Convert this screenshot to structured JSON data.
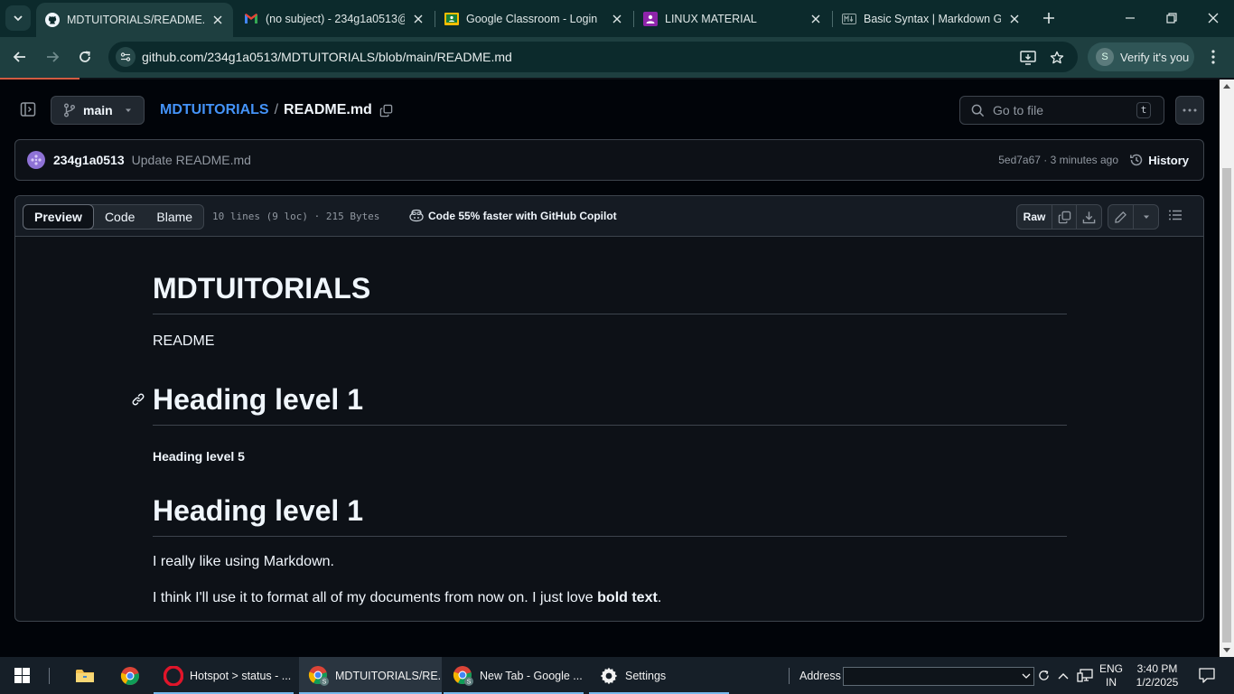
{
  "browser": {
    "tabs": [
      {
        "title": "MDTUITORIALS/README.md",
        "icon": "github-icon",
        "active": true
      },
      {
        "title": "(no subject) - 234g1a0513@",
        "icon": "gmail-icon",
        "active": false
      },
      {
        "title": "Google Classroom - Login",
        "icon": "classroom-icon",
        "active": false
      },
      {
        "title": "LINUX MATERIAL",
        "icon": "classroom-purple-icon",
        "active": false
      },
      {
        "title": "Basic Syntax | Markdown Gu",
        "icon": "markdown-icon",
        "active": false
      }
    ],
    "url": "github.com/234g1a0513/MDTUITORIALS/blob/main/README.md",
    "profile_initial": "S",
    "verify_label": "Verify it's you"
  },
  "repo": {
    "branch": "main",
    "repo_name": "MDTUITORIALS",
    "separator": "/",
    "file_name": "README.md",
    "go_to_file_placeholder": "Go to file",
    "shortcut_key": "t"
  },
  "commit": {
    "author": "234g1a0513",
    "message": "Update README.md",
    "meta": "5ed7a67 · 3 minutes ago",
    "history_label": "History"
  },
  "file_header": {
    "tabs": [
      "Preview",
      "Code",
      "Blame"
    ],
    "active_tab": "Preview",
    "stats": "10 lines (9 loc) · 215 Bytes",
    "copilot_label": "Code 55% faster with GitHub Copilot",
    "raw_label": "Raw"
  },
  "markdown": {
    "title": "MDTUITORIALS",
    "subtitle": "README",
    "heading_1a": "Heading level 1",
    "heading_5": "Heading level 5",
    "heading_1b": "Heading level 1",
    "para_1": "I really like using Markdown.",
    "para_2_before": "I think I'll use it to format all of my documents from now on. I just love ",
    "para_2_bold": "bold text",
    "para_2_after": "."
  },
  "taskbar": {
    "items": [
      {
        "label": "Hotspot > status - ...",
        "icon": "opera-icon"
      },
      {
        "label": "MDTUITORIALS/RE...",
        "icon": "chrome-profile-icon"
      },
      {
        "label": "New Tab - Google ...",
        "icon": "chrome-profile-icon"
      },
      {
        "label": "Settings",
        "icon": "gear-icon"
      }
    ],
    "address_label": "Address",
    "lang_top": "ENG",
    "lang_bottom": "IN",
    "time": "3:40 PM",
    "date": "1/2/2025"
  },
  "colors": {
    "link_blue": "#4493f8",
    "page_bg": "#0d1117",
    "browser_frame": "#1e3f40",
    "accent_underline": "#d35a41"
  }
}
